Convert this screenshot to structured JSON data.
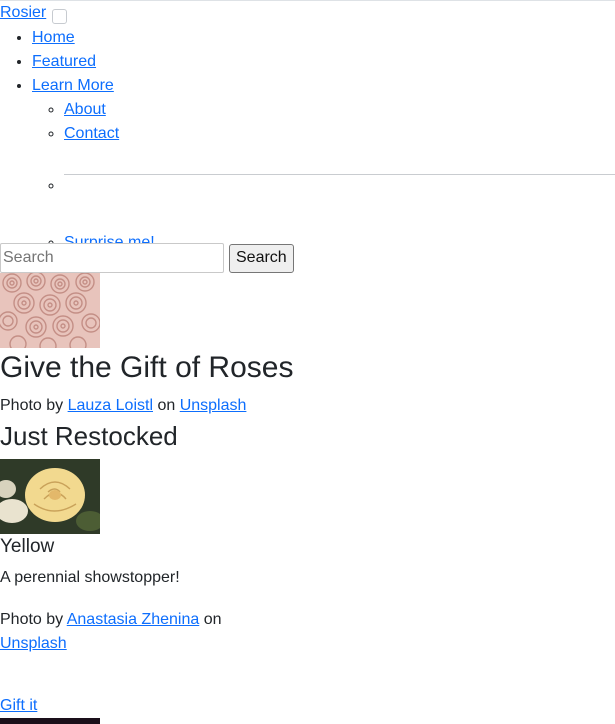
{
  "brand": "Rosier",
  "nav": {
    "items": [
      {
        "label": "Home"
      },
      {
        "label": "Featured"
      },
      {
        "label": "Learn More"
      }
    ],
    "submenu": [
      {
        "label": "About"
      },
      {
        "label": "Contact"
      },
      {
        "label": "Surprise me!"
      }
    ]
  },
  "search": {
    "placeholder": "Search",
    "button_label": "Search"
  },
  "hero": {
    "title": "Give the Gift of Roses",
    "credit_prefix": "Photo by",
    "photographer": "Lauza Loistl",
    "on": "on",
    "source": "Unsplash"
  },
  "section": {
    "title": "Just Restocked"
  },
  "card": {
    "title": "Yellow",
    "description": "A perennial showstopper!",
    "credit_prefix": "Photo by",
    "photographer": "Anastasia Zhenina",
    "on": "on",
    "source": "Unsplash",
    "cta": "Gift it"
  }
}
